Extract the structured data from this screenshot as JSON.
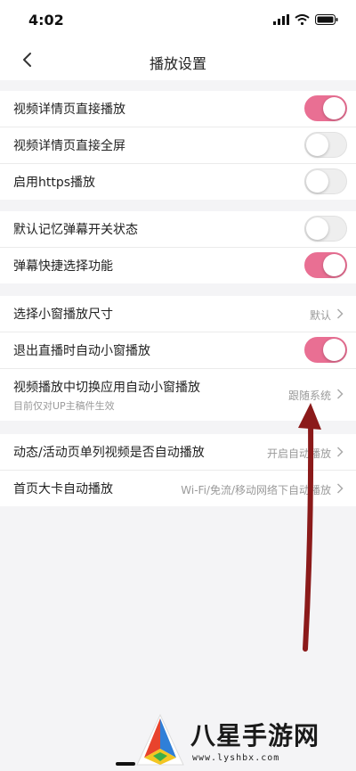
{
  "status": {
    "time": "4:02"
  },
  "nav": {
    "title": "播放设置"
  },
  "group1": [
    {
      "label": "视频详情页直接播放",
      "toggle": true
    },
    {
      "label": "视频详情页直接全屏",
      "toggle": false
    },
    {
      "label": "启用https播放",
      "toggle": false
    }
  ],
  "group2": [
    {
      "label": "默认记忆弹幕开关状态",
      "toggle": false
    },
    {
      "label": "弹幕快捷选择功能",
      "toggle": true
    }
  ],
  "group3": {
    "window_size": {
      "label": "选择小窗播放尺寸",
      "value": "默认"
    },
    "live_exit": {
      "label": "退出直播时自动小窗播放",
      "toggle": true
    },
    "switch_app": {
      "label": "视频播放中切换应用自动小窗播放",
      "sub": "目前仅对UP主稿件生效",
      "value": "跟随系统"
    }
  },
  "group4": {
    "activity": {
      "label": "动态/活动页单列视频是否自动播放",
      "value": "开启自动播放"
    },
    "home_card": {
      "label": "首页大卡自动播放",
      "value": "Wi-Fi/免流/移动网络下自动播放"
    }
  },
  "watermark": {
    "title": "八星手游网",
    "url": "www.lyshbx.com"
  },
  "colors": {
    "accent": "#e96f93",
    "annotation_arrow": "#8b1a1a"
  },
  "icons": {
    "back": "chevron-left-icon",
    "row_arrow": "chevron-right-icon"
  }
}
